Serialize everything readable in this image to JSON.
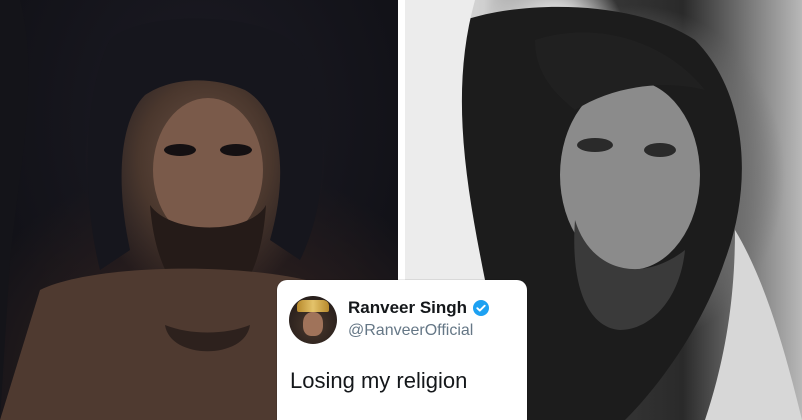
{
  "images": {
    "left_photo": "man-with-long-hair-and-beard-dark-photo",
    "right_photo": "man-with-long-hair-black-and-white-photo"
  },
  "tweet": {
    "display_name": "Ranveer Singh",
    "handle": "@RanveerOfficial",
    "text": "Losing my religion",
    "verified_icon": "verified-badge-icon",
    "verified_color": "#1da1f2"
  }
}
